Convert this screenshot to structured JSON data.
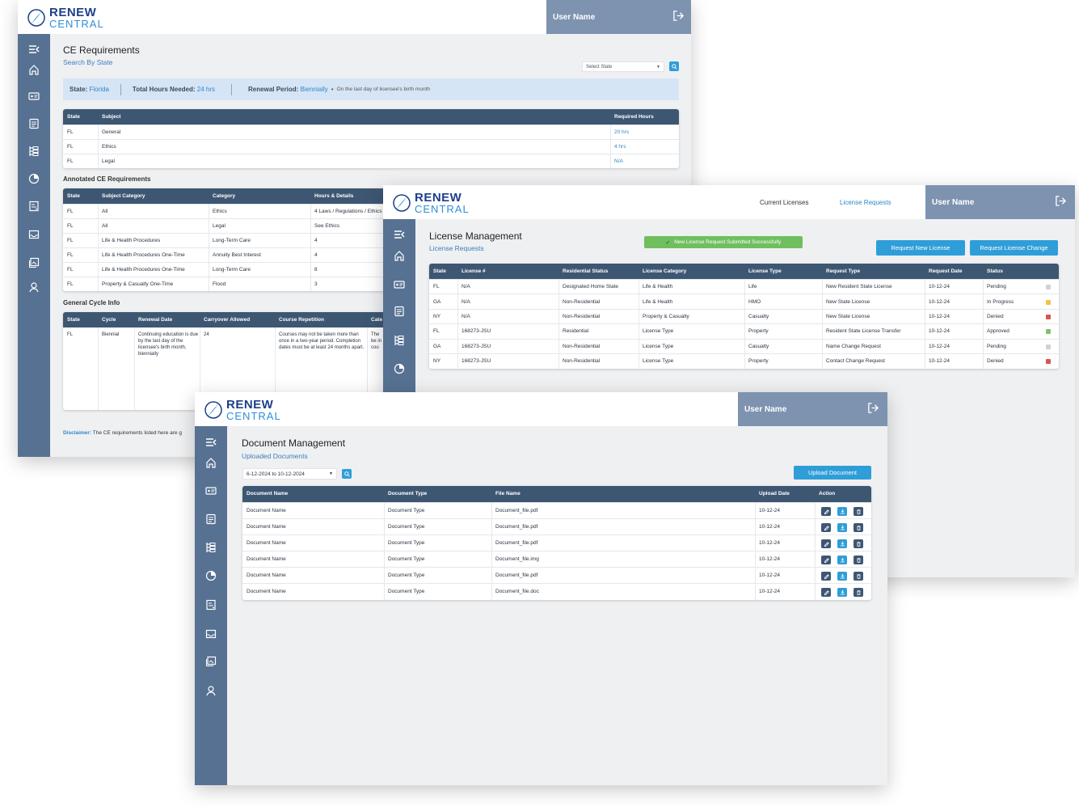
{
  "brand": {
    "line1": "RENEW",
    "line2": "CENTRAL"
  },
  "colors": {
    "sidebar": "#577192",
    "header_dark": "#3d5773",
    "accent": "#2f9ed8",
    "user_bar": "#7d93b0",
    "success": "#6fbf5f",
    "pending": "#cfd2d6",
    "in_progress": "#f0c34a",
    "denied": "#d85454",
    "approved": "#7fc26a"
  },
  "icons": [
    "menu-collapse-icon",
    "home-icon",
    "id-card-icon",
    "document-icon",
    "hierarchy-icon",
    "pie-chart-icon",
    "report-icon",
    "mail-icon",
    "gallery-icon",
    "profile-icon",
    "logout-icon",
    "search-icon",
    "edit-icon",
    "download-icon",
    "trash-icon",
    "check-icon",
    "chevron-down-icon"
  ],
  "ce": {
    "user_name": "User Name",
    "title": "CE Requirements",
    "subtitle": "Search By State",
    "select_placeholder": "Select State",
    "info": {
      "state_label": "State:",
      "state_value": "Florida",
      "hours_label": "Total Hours Needed:",
      "hours_value": "24 hrs",
      "period_label": "Renewal Period:",
      "period_value": "Biennially",
      "period_note": "On the last day of licensee's birth month"
    },
    "req_table": {
      "headers": [
        "State",
        "Subject",
        "Required Hours"
      ],
      "rows": [
        [
          "FL",
          "General",
          "20 hrs"
        ],
        [
          "FL",
          "Ethics",
          "4 hrs"
        ],
        [
          "FL",
          "Legal",
          "N/A"
        ]
      ]
    },
    "annotated_title": "Annotated CE Requirements",
    "annotated_table": {
      "headers": [
        "State",
        "Subject Category",
        "Category",
        "Hours & Details"
      ],
      "rows": [
        [
          "FL",
          "All",
          "Ethics",
          "4 Laws / Regulations / Ethics"
        ],
        [
          "FL",
          "All",
          "Legal",
          "See Ethics"
        ],
        [
          "FL",
          "Life & Health Procedures",
          "Long-Term Care",
          "4"
        ],
        [
          "FL",
          "Life & Health Procedures One-Time",
          "Annuity Best Interest",
          "4"
        ],
        [
          "FL",
          "Life & Health Procedures One-Time",
          "Long-Term Care",
          "8"
        ],
        [
          "FL",
          "Property & Casualty One-Time",
          "Flood",
          "3"
        ]
      ]
    },
    "cycle_title": "General Cycle Info",
    "cycle_table": {
      "headers": [
        "State",
        "Cycle",
        "Renewal Date",
        "Carryover Allowed",
        "Course Repetition",
        "Cate"
      ],
      "row": {
        "state": "FL",
        "cycle": "Biennial",
        "renewal": "Continuing education is due by the last day of the licensee's birth month, biennially",
        "carryover": "24",
        "repetition": "Courses may not be taken more than once in a two-year period. Completion dates must be at least 24 months apart.",
        "cate": "The be in cou"
      }
    },
    "disclaimer_label": "Disclaimer:",
    "disclaimer_text": "The CE requirements listed here are g"
  },
  "lm": {
    "nav": [
      "Current Licenses",
      "License Requests"
    ],
    "user_name": "User Name",
    "title": "License Management",
    "subtitle": "License Requests",
    "toast": "New License Request Submitted Successfully",
    "btn_new": "Request New License",
    "btn_change": "Request License Change",
    "headers": [
      "State",
      "License #",
      "Residential Status",
      "License Category",
      "License Type",
      "Request Type",
      "Request Date",
      "Status"
    ],
    "rows": [
      {
        "c": [
          "FL",
          "N/A",
          "Designated Home State",
          "Life & Health",
          "Life",
          "New Resident State License",
          "10-12-24",
          "Pending"
        ],
        "s": "#cfd2d6"
      },
      {
        "c": [
          "GA",
          "N/A",
          "Non-Residential",
          "Life & Health",
          "HMO",
          "New State License",
          "10-12-24",
          "In Progress"
        ],
        "s": "#f0c34a"
      },
      {
        "c": [
          "NY",
          "N/A",
          "Non-Residential",
          "Property & Casualty",
          "Casualty",
          "New State License",
          "10-12-24",
          "Denied"
        ],
        "s": "#d85454"
      },
      {
        "c": [
          "FL",
          "168273-JSU",
          "Residential",
          "License Type",
          "Property",
          "Resident State License Transfer",
          "10-12-24",
          "Approved"
        ],
        "s": "#7fc26a"
      },
      {
        "c": [
          "GA",
          "168273-JSU",
          "Non-Residential",
          "License Type",
          "Casualty",
          "Name Change Request",
          "10-12-24",
          "Pending"
        ],
        "s": "#cfd2d6"
      },
      {
        "c": [
          "NY",
          "168273-JSU",
          "Non-Residential",
          "License Type",
          "Property",
          "Contact Change Request",
          "10-12-24",
          "Denied"
        ],
        "s": "#d85454"
      }
    ]
  },
  "dm": {
    "user_name": "User Name",
    "title": "Document Management",
    "subtitle": "Uploaded Documents",
    "date_range": "6-12-2024 to 10-12-2024",
    "btn_upload": "Upload Document",
    "headers": [
      "Document Name",
      "Document Type",
      "File Name",
      "Upload Date",
      "Action"
    ],
    "rows": [
      [
        "Document Name",
        "Document Type",
        "Document_file.pdf",
        "10-12-24"
      ],
      [
        "Document Name",
        "Document Type",
        "Document_file.pdf",
        "10-12-24"
      ],
      [
        "Document Name",
        "Document Type",
        "Document_file.pdf",
        "10-12-24"
      ],
      [
        "Document Name",
        "Document Type",
        "Document_file.img",
        "10-12-24"
      ],
      [
        "Document Name",
        "Document Type",
        "Document_file.pdf",
        "10-12-24"
      ],
      [
        "Document Name",
        "Document Type",
        "Document_file.doc",
        "10-12-24"
      ]
    ]
  }
}
